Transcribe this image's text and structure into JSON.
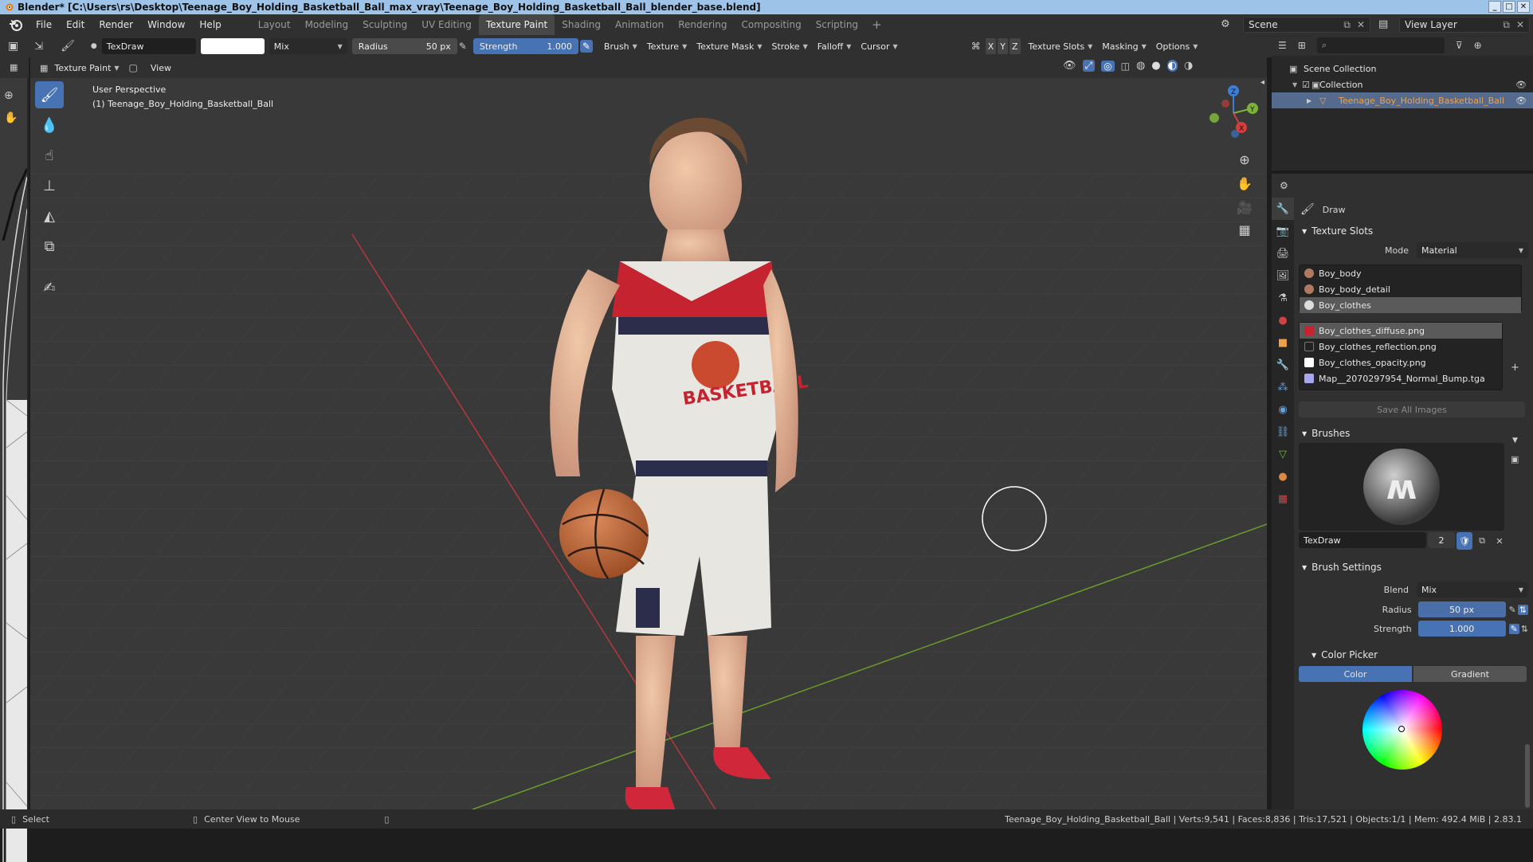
{
  "title": "Blender* [C:\\Users\\rs\\Desktop\\Teenage_Boy_Holding_Basketball_Ball_max_vray\\Teenage_Boy_Holding_Basketball_Ball_blender_base.blend]",
  "menu": [
    "File",
    "Edit",
    "Render",
    "Window",
    "Help"
  ],
  "workspaces": [
    "Layout",
    "Modeling",
    "Sculpting",
    "UV Editing",
    "Texture Paint",
    "Shading",
    "Animation",
    "Rendering",
    "Compositing",
    "Scripting"
  ],
  "active_workspace": "Texture Paint",
  "scene": "Scene",
  "view_layer": "View Layer",
  "tool_header": {
    "brush_name": "TexDraw",
    "blend": "Mix",
    "radius_label": "Radius",
    "radius_value": "50 px",
    "strength_label": "Strength",
    "strength_value": "1.000",
    "menus": [
      "Brush",
      "Texture",
      "Texture Mask",
      "Stroke",
      "Falloff",
      "Cursor"
    ],
    "axes": [
      "X",
      "Y",
      "Z"
    ],
    "right_menus": [
      "Texture Slots",
      "Masking",
      "Options"
    ]
  },
  "viewport_header": {
    "mode": "Texture Paint",
    "view": "View"
  },
  "viewport": {
    "perspective": "User Perspective",
    "object": "(1) Teenage_Boy_Holding_Basketball_Ball"
  },
  "gizmo": {
    "x": "X",
    "y": "Y",
    "z": "Z"
  },
  "outliner": {
    "scene_collection": "Scene Collection",
    "collection": "Collection",
    "object": "Teenage_Boy_Holding_Basketball_Ball"
  },
  "properties": {
    "tool": "Draw",
    "texture_slots_title": "Texture Slots",
    "mode_label": "Mode",
    "mode_value": "Material",
    "materials": [
      "Boy_body",
      "Boy_body_detail",
      "Boy_clothes"
    ],
    "images": [
      "Boy_clothes_diffuse.png",
      "Boy_clothes_reflection.png",
      "Boy_clothes_opacity.png",
      "Map__2070297954_Normal_Bump.tga"
    ],
    "save_all": "Save All Images",
    "brushes_title": "Brushes",
    "brush_name": "TexDraw",
    "brush_users": "2",
    "brush_settings_title": "Brush Settings",
    "blend_label": "Blend",
    "blend_value": "Mix",
    "radius_label": "Radius",
    "radius_value": "50 px",
    "strength_label": "Strength",
    "strength_value": "1.000",
    "color_picker_title": "Color Picker",
    "color_tab": "Color",
    "gradient_tab": "Gradient"
  },
  "status": {
    "select": "Select",
    "center": "Center View to Mouse",
    "stats": "Teenage_Boy_Holding_Basketball_Ball | Verts:9,541 | Faces:8,836 | Tris:17,521 | Objects:1/1 | Mem: 492.4 MiB | 2.83.1"
  },
  "colors": {
    "accent": "#4772b3",
    "selection": "#546b8e",
    "x_axis": "#d63d3d",
    "y_axis": "#7bb33a",
    "z_axis": "#3d7fd6",
    "active_object": "#f0a04b"
  },
  "icons": [
    "blender-logo",
    "paint-brush-icon",
    "fill-icon",
    "smear-icon",
    "clone-icon",
    "soften-icon",
    "mask-icon",
    "annotate-icon",
    "zoom-icon",
    "hand-icon",
    "camera-icon",
    "grid-icon",
    "eye-icon",
    "filter-icon",
    "search-icon"
  ]
}
